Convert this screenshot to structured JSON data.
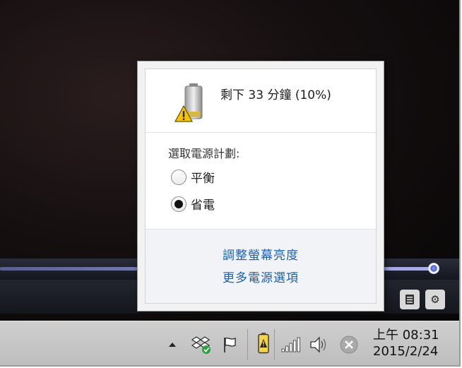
{
  "flyout": {
    "battery_status": "剩下 33 分鐘 (10%)",
    "plan_heading": "選取電源計劃:",
    "plans": [
      {
        "label": "平衡",
        "selected": false
      },
      {
        "label": "省電",
        "selected": true
      }
    ],
    "links": {
      "adjust_brightness": "調整螢幕亮度",
      "more_power_options": "更多電源選項"
    }
  },
  "player": {
    "progress": 0.94
  },
  "taskbar": {
    "icons": [
      "chevron-up-icon",
      "dropbox-icon",
      "action-center-flag-icon",
      "battery-icon",
      "network-signal-icon",
      "volume-icon",
      "close-circle-icon"
    ],
    "clock": {
      "time": "上午 08:31",
      "date": "2015/2/24"
    }
  },
  "colors": {
    "link": "#1f5fae",
    "taskbar": "#c6c6c6",
    "accent_slider": "#4a5acc"
  }
}
